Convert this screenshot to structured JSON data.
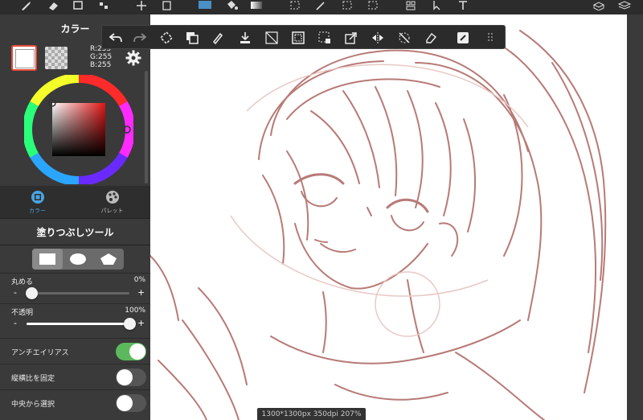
{
  "app_toolbar": {
    "icons": [
      "brush-icon",
      "eraser-icon",
      "rect-select-icon",
      "dots-icon",
      "move-icon",
      "transform-icon",
      "color-swatch-icon",
      "fill-bucket-icon",
      "gradient-icon",
      "lasso-select-icon",
      "magic-wand-icon",
      "select-pen-icon",
      "select-eraser-icon",
      "layout-icon",
      "pointer-icon",
      "text-icon",
      "materials-icon",
      "layers-icon"
    ]
  },
  "color_panel": {
    "title": "カラー",
    "rgb": {
      "r": "R:255",
      "g": "G:255",
      "b": "B:255"
    },
    "main_color": "#ffffff",
    "tabs": [
      {
        "label": "カラー",
        "icon": "color-tab-icon",
        "active": true
      },
      {
        "label": "パレット",
        "icon": "palette-icon",
        "active": false
      }
    ]
  },
  "tool_panel": {
    "title": "塗りつぶしツール",
    "shapes": [
      "rectangle-icon",
      "ellipse-icon",
      "polygon-icon"
    ],
    "settings": {
      "round": {
        "label": "丸める",
        "value": "0%",
        "level": 0.0
      },
      "opacity": {
        "label": "不透明",
        "value": "100%",
        "level": 1.0
      }
    },
    "toggles": [
      {
        "label": "アンチエイリアス",
        "on": true
      },
      {
        "label": "縦横比を固定",
        "on": false
      },
      {
        "label": "中央から選択",
        "on": false
      }
    ]
  },
  "floating_toolbar": {
    "buttons": [
      "undo-icon",
      "redo-icon",
      "invert-selection-icon",
      "fill-layer-icon",
      "pen-icon",
      "download-icon",
      "clear-icon",
      "select-all-icon",
      "snap-icon",
      "copy-paste-icon",
      "flip-icon",
      "deselect-icon",
      "eraser-clear-icon",
      "fill-toggle-icon",
      "more-icon"
    ]
  },
  "status": {
    "text": "1300*1300px 350dpi 207%"
  },
  "colors": {
    "accent_blue": "#4aa3df",
    "toggle_green": "#5cb85c",
    "sketch_line": "#b77a76"
  }
}
